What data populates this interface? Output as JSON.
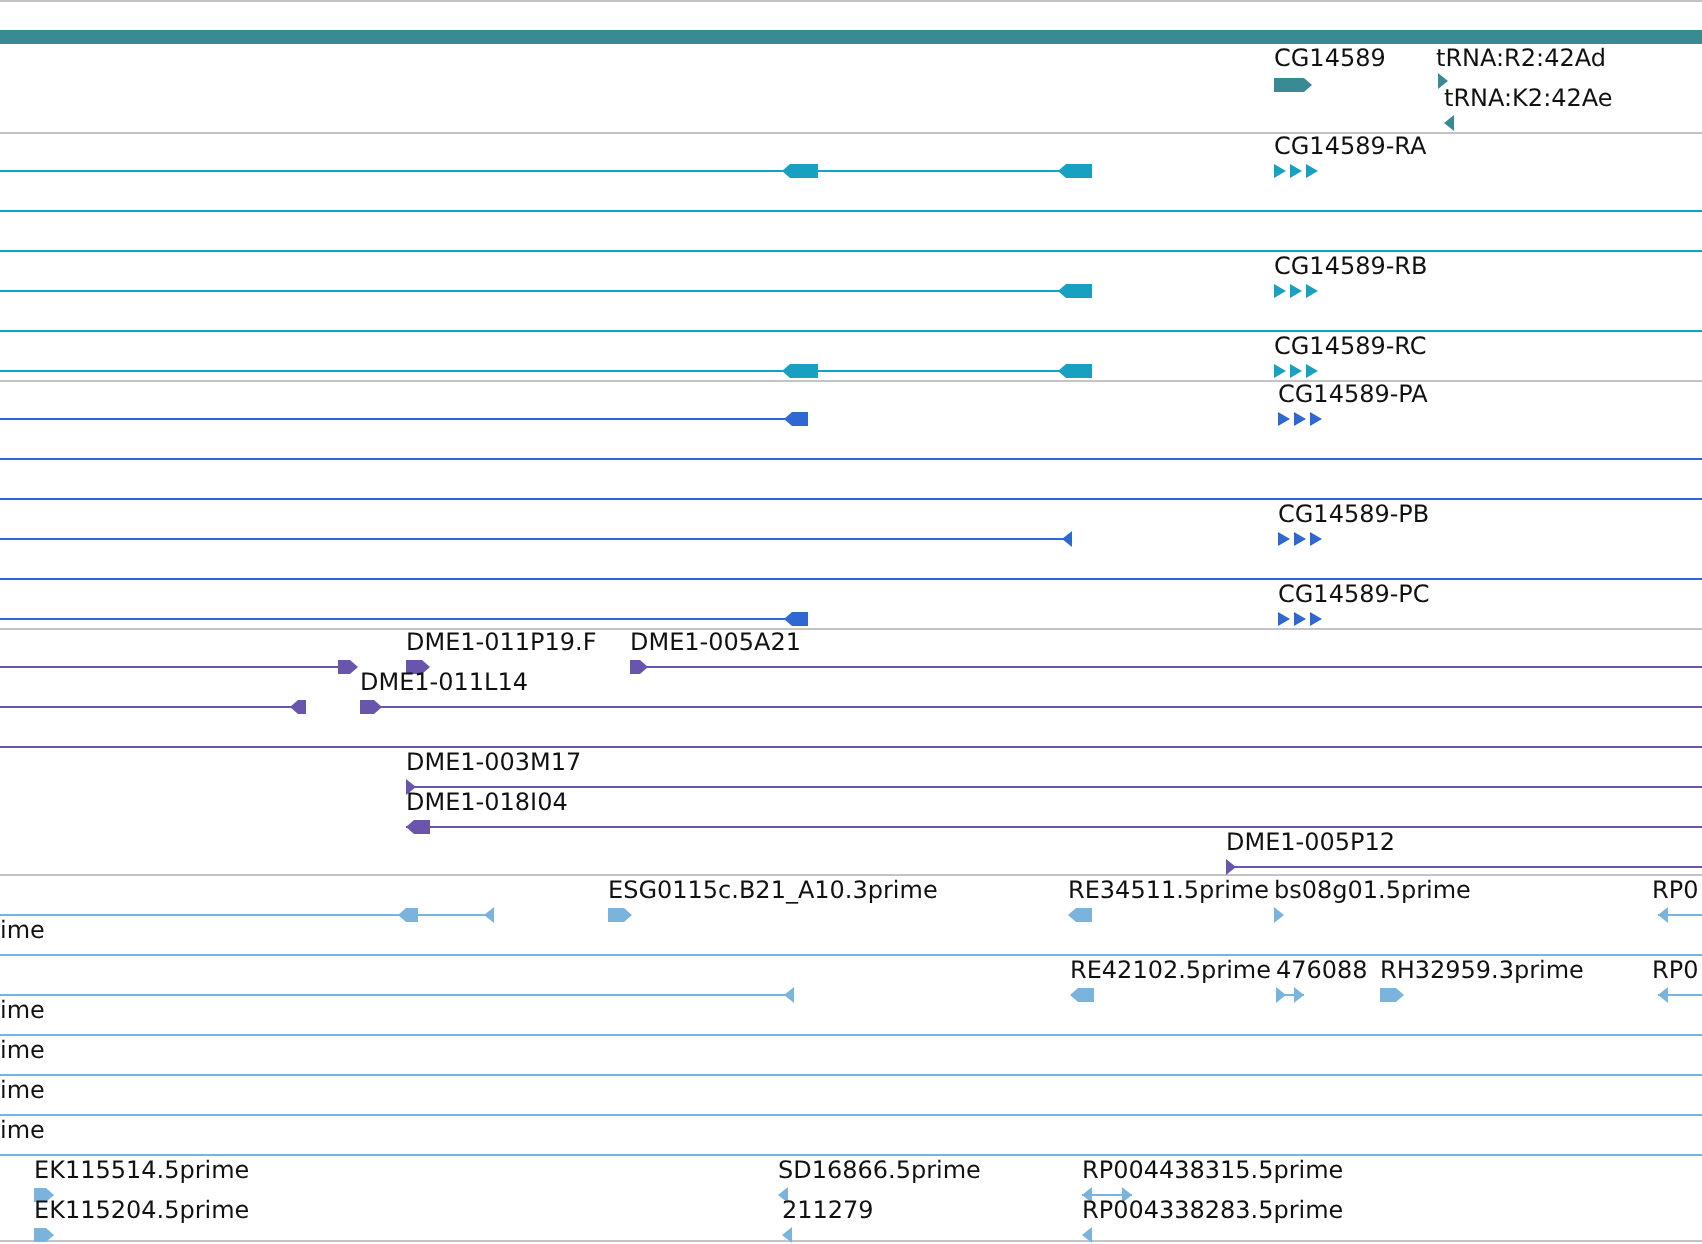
{
  "tracks": [
    {
      "kind": "gene",
      "color": "#3a8a94",
      "labels": [
        "CG14589",
        "tRNA:R2:42Ad",
        "tRNA:K2:42Ae"
      ]
    },
    {
      "kind": "transcript",
      "color": "#18a0c2",
      "labels": [
        "CG14589-RA",
        "CG14589-RB",
        "CG14589-RC"
      ]
    },
    {
      "kind": "protein",
      "color": "#2f68d0",
      "labels": [
        "CG14589-PA",
        "CG14589-PB",
        "CG14589-PC"
      ]
    },
    {
      "kind": "clone",
      "color": "#6a55ad",
      "labels": [
        "DME1-011P19.F",
        "DME1-005A21",
        "DME1-011L14",
        "DME1-003M17",
        "DME1-018I04",
        "DME1-005P12"
      ]
    },
    {
      "kind": "est",
      "color": "#7ab4dc",
      "labels": [
        "ESG0115c.B21_A10.3prime",
        "RE34511.5prime",
        "bs08g01.5prime",
        "RP0",
        "ime",
        "RE42102.5prime",
        "476088",
        "RH32959.3prime",
        "RP0",
        "ime",
        "ime",
        "ime",
        "ime",
        "EK115514.5prime",
        "SD16866.5prime",
        "RP004438315.5prime",
        "EK115204.5prime",
        "211279",
        "RP004338283.5prime"
      ]
    }
  ]
}
